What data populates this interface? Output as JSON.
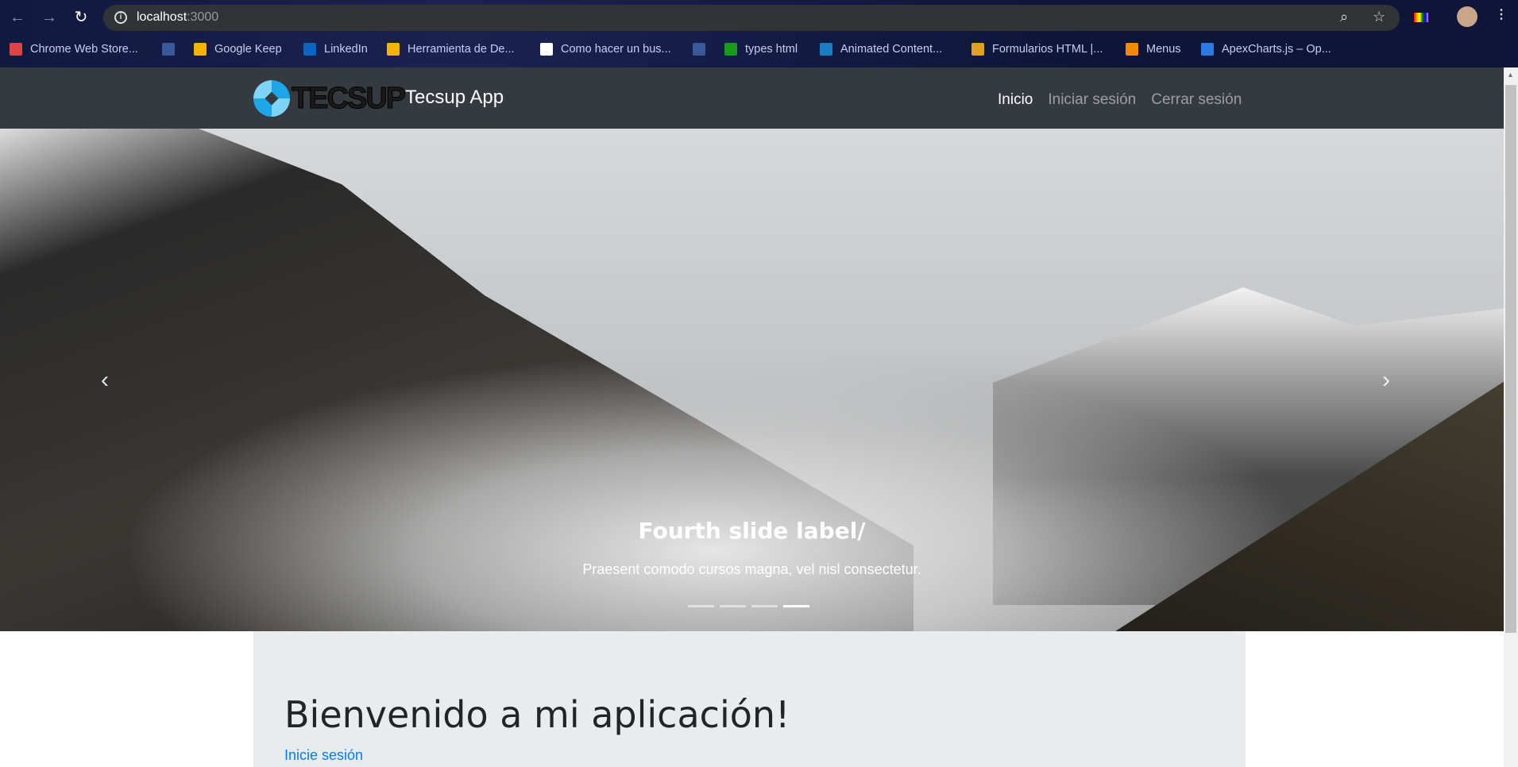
{
  "browser": {
    "url_host": "localhost",
    "url_port": ":3000",
    "bookmarks": [
      {
        "label": "Chrome Web Store...",
        "icon": "chrome-store-icon",
        "color": "#d44"
      },
      {
        "label": "",
        "icon": "facebook-icon",
        "color": "#3b5998"
      },
      {
        "label": "Google Keep",
        "icon": "google-keep-icon",
        "color": "#f4b400"
      },
      {
        "label": "LinkedIn",
        "icon": "linkedin-icon",
        "color": "#0a66c2"
      },
      {
        "label": "Herramienta de De...",
        "icon": "devtools-icon",
        "color": "#f4b400"
      },
      {
        "label": "Como hacer un bus...",
        "icon": "globe-icon",
        "color": "#fff"
      },
      {
        "label": "",
        "icon": "facebook-icon",
        "color": "#3b5998"
      },
      {
        "label": "types html",
        "icon": "checkmark-icon",
        "color": "#1a9a1a"
      },
      {
        "label": "Animated Content...",
        "icon": "drop-icon",
        "color": "#1a7ec0"
      },
      {
        "label": "Formularios HTML |...",
        "icon": "form-icon",
        "color": "#e0a020"
      },
      {
        "label": "Menus",
        "icon": "flame-icon",
        "color": "#f08a00"
      },
      {
        "label": "ApexCharts.js – Op...",
        "icon": "apexcharts-icon",
        "color": "#2a7ae2"
      }
    ]
  },
  "navbar": {
    "logo_text": "TECSUP",
    "brand": "Tecsup App",
    "links": [
      {
        "label": "Inicio",
        "active": true
      },
      {
        "label": "Iniciar sesión"
      },
      {
        "label": "Cerrar sesión"
      }
    ]
  },
  "carousel": {
    "title": "Fourth slide label/",
    "text": "Praesent comodo cursos magna, vel nisl consectetur.",
    "slides": 4,
    "active_index": 3
  },
  "jumbotron": {
    "title": "Bienvenido a mi aplicación!",
    "link": "Inicie sesión"
  }
}
